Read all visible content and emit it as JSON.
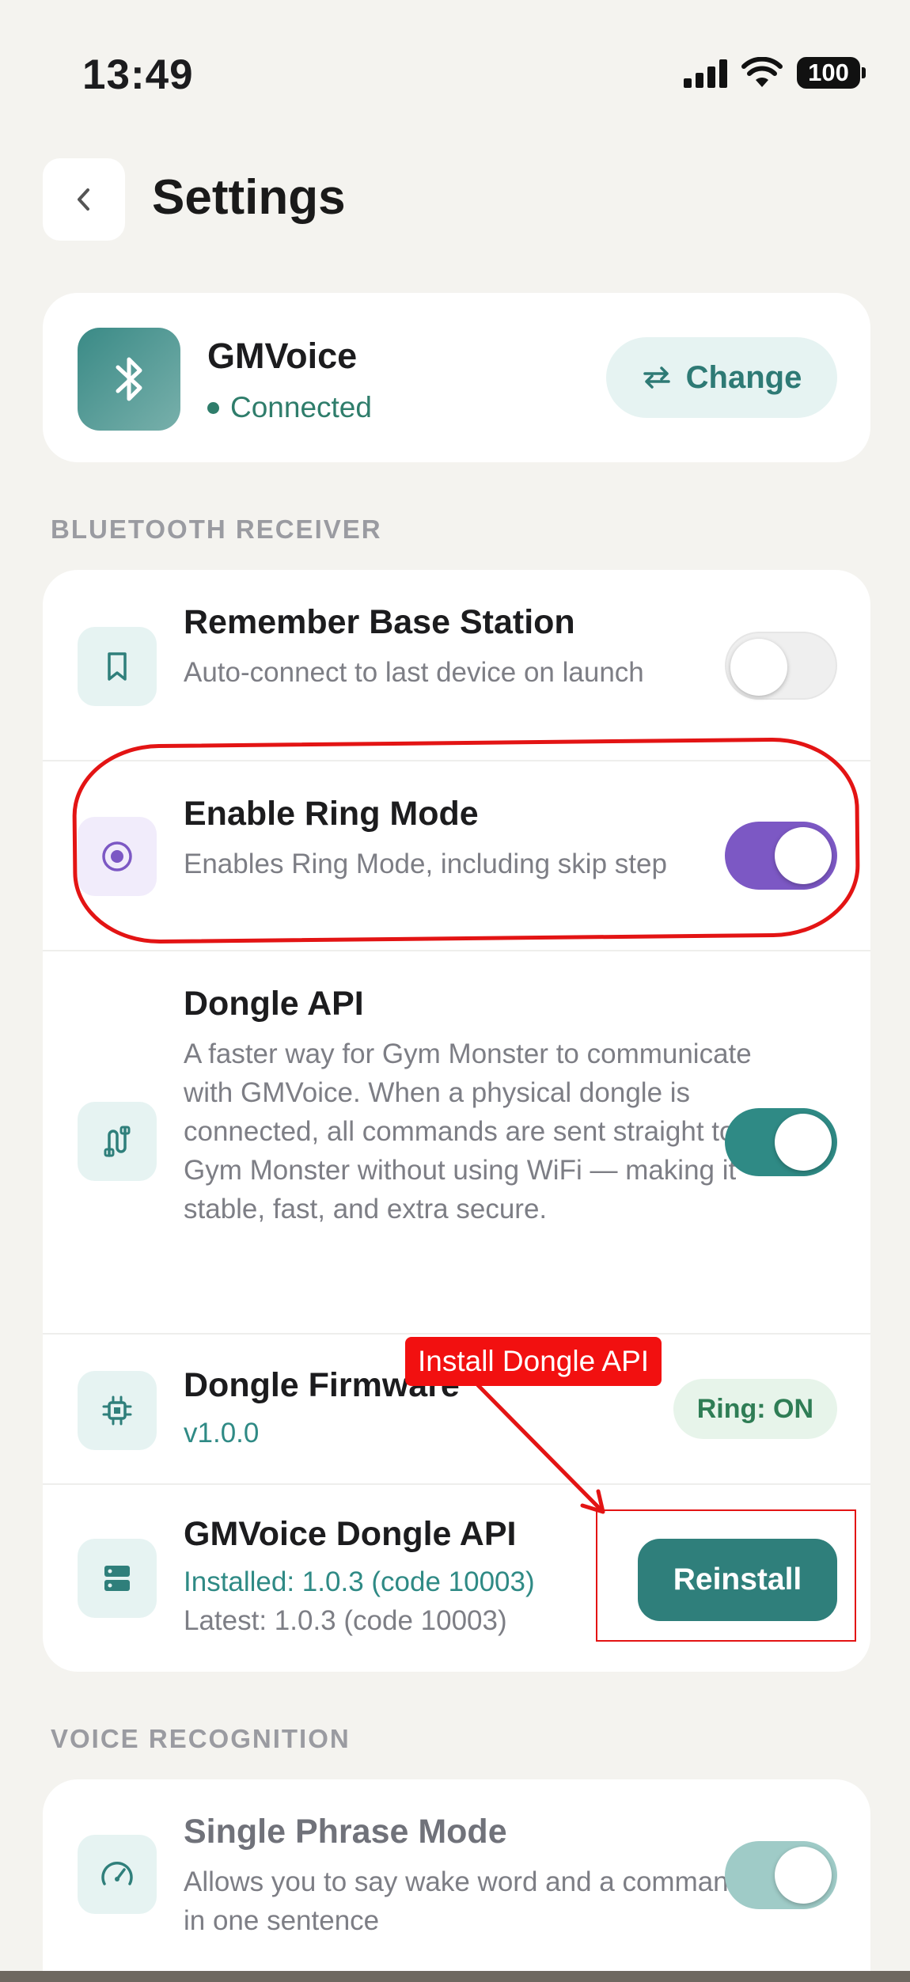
{
  "status_bar": {
    "time": "13:49",
    "battery": "100",
    "icons": [
      "cellular-signal-icon",
      "wifi-icon",
      "battery-icon"
    ]
  },
  "header": {
    "title": "Settings",
    "back_icon": "chevron-left-icon"
  },
  "device": {
    "name": "GMVoice",
    "status": "Connected",
    "change_label": "Change",
    "icon": "bluetooth-icon"
  },
  "sections": {
    "bluetooth": "BLUETOOTH RECEIVER",
    "voice": "VOICE RECOGNITION"
  },
  "bluetooth_rows": [
    {
      "title": "Remember Base Station",
      "desc": "Auto-connect to last device on launch",
      "toggle": "off",
      "icon": "bookmark-icon"
    },
    {
      "title": "Enable Ring Mode",
      "desc": "Enables Ring Mode, including skip step",
      "toggle": "on",
      "icon": "radio-target-icon"
    },
    {
      "title": "Dongle API",
      "desc": "A faster way for Gym Monster to communicate with GMVoice. When a physical dongle is connected, all commands are sent straight to Gym Monster without using WiFi — making it stable, fast, and extra secure.",
      "toggle": "on",
      "icon": "cable-plug-icon"
    },
    {
      "title": "Dongle Firmware",
      "version": "v1.0.0",
      "badge": "Ring: ON",
      "icon": "chip-icon"
    },
    {
      "title": "GMVoice Dongle API",
      "installed": "Installed: 1.0.3 (code 10003)",
      "latest": "Latest: 1.0.3 (code 10003)",
      "button": "Reinstall",
      "icon": "server-icon"
    }
  ],
  "voice_rows": [
    {
      "title": "Single Phrase Mode",
      "desc": "Allows you to say wake word and a command in one sentence",
      "toggle": "on",
      "icon": "speedometer-icon"
    }
  ],
  "annotation": {
    "callout_text": "Install Dongle API"
  },
  "colors": {
    "accent_teal": "#2f7f7b",
    "ring_purple": "#7c58c4",
    "annotation_red": "#e31414"
  }
}
